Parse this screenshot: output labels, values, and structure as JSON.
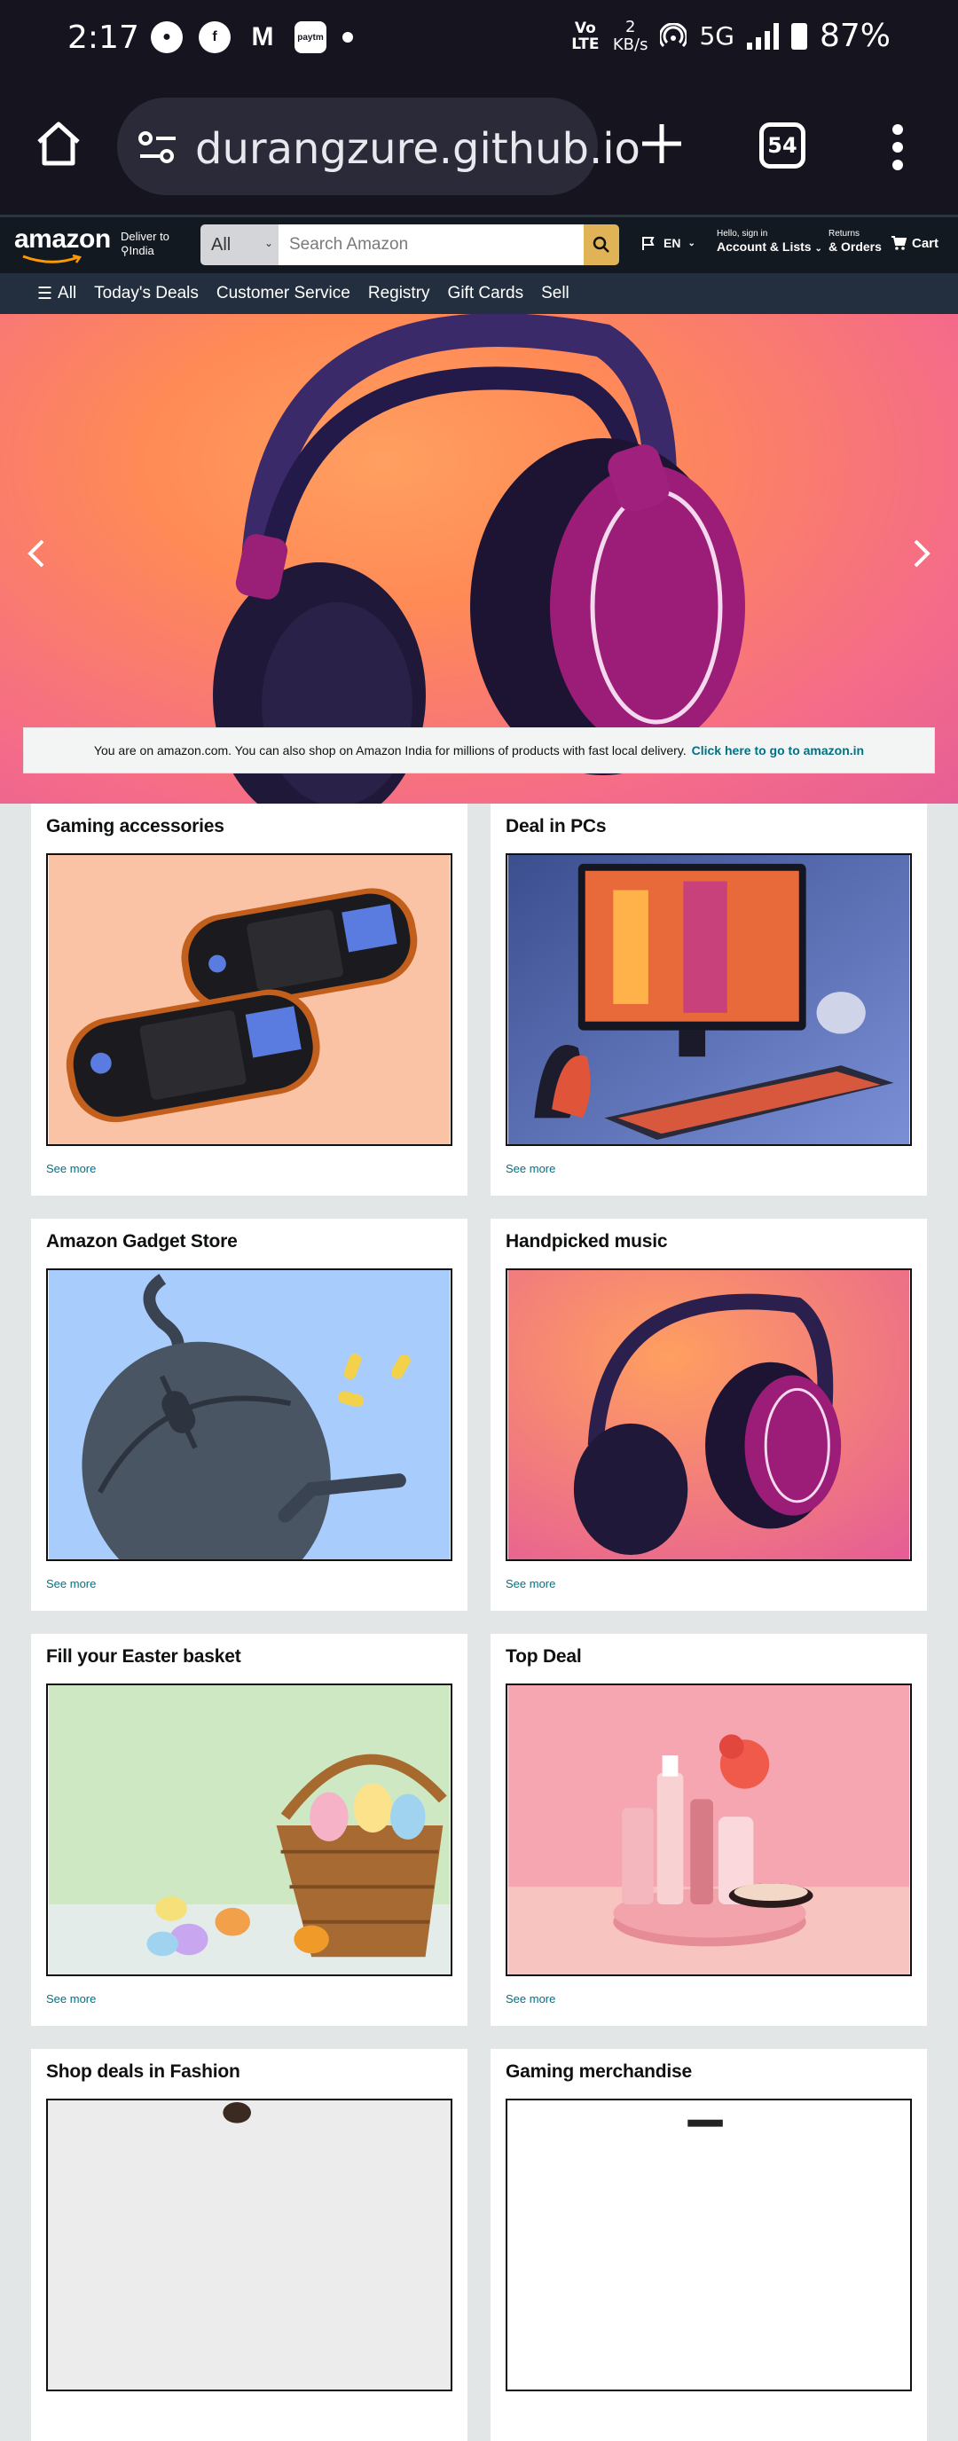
{
  "status_bar": {
    "time": "2:17",
    "left_icons": [
      "bag-icon",
      "facebook-icon",
      "gmail-icon",
      "paytm-icon",
      "dot-icon"
    ],
    "volte": "Vo LTE",
    "speed_value": "2",
    "speed_unit": "KB/s",
    "network": "5G",
    "battery": "87%"
  },
  "browser": {
    "url": "durangzure.github.io",
    "tab_count": "54"
  },
  "amazon": {
    "logo": "amazon",
    "deliver_line1": "Deliver to",
    "deliver_line2": "India",
    "search_category": "All",
    "search_placeholder": "Search Amazon",
    "language": "EN",
    "account_line1": "Hello, sign in",
    "account_line2": "Account & Lists",
    "orders_line1": "Returns",
    "orders_line2": "& Orders",
    "cart": "Cart",
    "subnav": {
      "all": "All",
      "items": [
        "Today's Deals",
        "Customer Service",
        "Registry",
        "Gift Cards",
        "Sell"
      ]
    },
    "notice": {
      "text": "You are on amazon.com. You can also shop on Amazon India for millions of products with fast local delivery.",
      "link": "Click here to go to amazon.in"
    },
    "cards": [
      {
        "title": "Gaming accessories",
        "link": "See more"
      },
      {
        "title": "Deal in PCs",
        "link": "See more"
      },
      {
        "title": "Amazon Gadget Store",
        "link": "See more"
      },
      {
        "title": "Handpicked music",
        "link": "See more"
      },
      {
        "title": "Fill your Easter basket",
        "link": "See more"
      },
      {
        "title": "Top Deal",
        "link": "See more"
      },
      {
        "title": "Shop deals in Fashion",
        "link": ""
      },
      {
        "title": "Gaming merchandise",
        "link": ""
      }
    ]
  },
  "colors": {
    "amazon_nav": "#131921",
    "amazon_subnav": "#232f3e",
    "search_button": "#e0b456",
    "link": "#007185",
    "browser_bg": "#15141f"
  }
}
